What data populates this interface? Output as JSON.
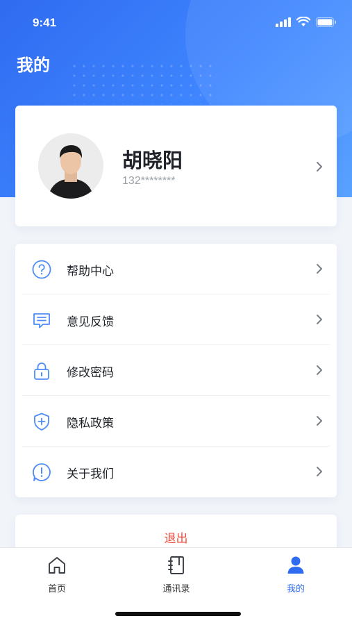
{
  "status_bar": {
    "time": "9:41"
  },
  "page": {
    "title": "我的"
  },
  "profile": {
    "name": "胡晓阳",
    "phone": "132********"
  },
  "menu": {
    "items": [
      {
        "label": "帮助中心",
        "icon": "help-icon"
      },
      {
        "label": "意见反馈",
        "icon": "feedback-icon"
      },
      {
        "label": "修改密码",
        "icon": "lock-icon"
      },
      {
        "label": "隐私政策",
        "icon": "shield-icon"
      },
      {
        "label": "关于我们",
        "icon": "info-icon"
      }
    ]
  },
  "logout": {
    "label": "退出"
  },
  "tabbar": {
    "tabs": [
      {
        "label": "首页",
        "icon": "home-icon",
        "active": false
      },
      {
        "label": "通讯录",
        "icon": "contacts-icon",
        "active": false
      },
      {
        "label": "我的",
        "icon": "user-icon",
        "active": true
      }
    ]
  },
  "colors": {
    "primary": "#2f6bf0",
    "danger": "#f04a3a",
    "icon_blue": "#4d8df5"
  }
}
